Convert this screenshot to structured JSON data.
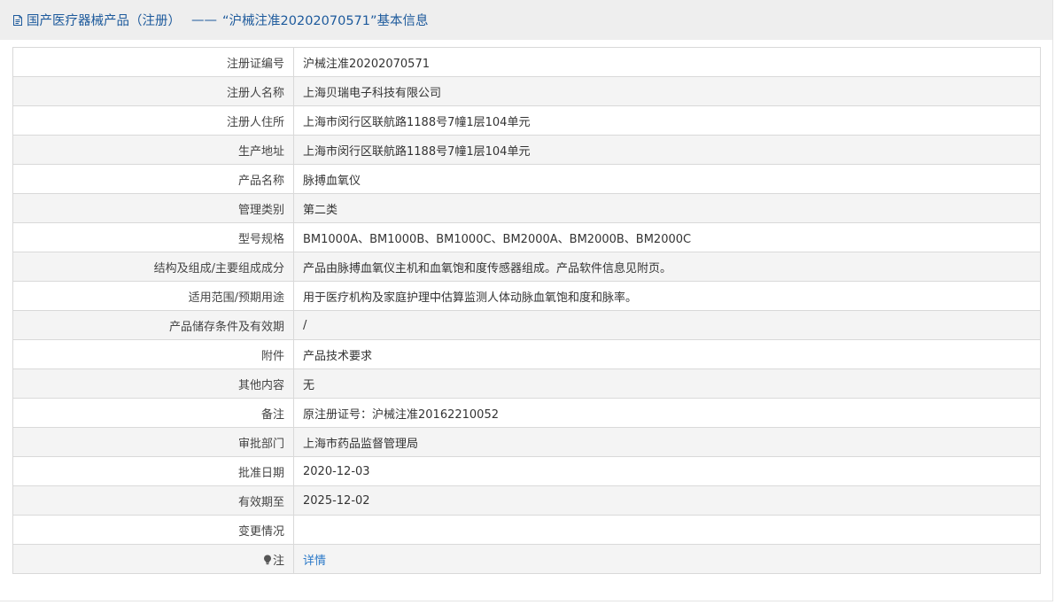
{
  "header": {
    "title_prefix": "国产医疗器械产品（注册）",
    "title_dash": "——",
    "title_main": "“沪械注准20202070571”基本信息",
    "icon": "document-icon"
  },
  "rows": [
    {
      "label": "注册证编号",
      "value": "沪械注准20202070571"
    },
    {
      "label": "注册人名称",
      "value": "上海贝瑞电子科技有限公司"
    },
    {
      "label": "注册人住所",
      "value": "上海市闵行区联航路1188号7幢1层104单元"
    },
    {
      "label": "生产地址",
      "value": "上海市闵行区联航路1188号7幢1层104单元"
    },
    {
      "label": "产品名称",
      "value": "脉搏血氧仪"
    },
    {
      "label": "管理类别",
      "value": "第二类"
    },
    {
      "label": "型号规格",
      "value": "BM1000A、BM1000B、BM1000C、BM2000A、BM2000B、BM2000C"
    },
    {
      "label": "结构及组成/主要组成成分",
      "value": "产品由脉搏血氧仪主机和血氧饱和度传感器组成。产品软件信息见附页。"
    },
    {
      "label": "适用范围/预期用途",
      "value": "用于医疗机构及家庭护理中估算监测人体动脉血氧饱和度和脉率。"
    },
    {
      "label": "产品储存条件及有效期",
      "value": "/"
    },
    {
      "label": "附件",
      "value": "产品技术要求"
    },
    {
      "label": "其他内容",
      "value": "无"
    },
    {
      "label": "备注",
      "value": "原注册证号：沪械注准20162210052"
    },
    {
      "label": "审批部门",
      "value": "上海市药品监督管理局"
    },
    {
      "label": "批准日期",
      "value": "2020-12-03"
    },
    {
      "label": "有效期至",
      "value": "2025-12-02"
    },
    {
      "label": "变更情况",
      "value": ""
    }
  ],
  "note_row": {
    "icon": "lightbulb-icon",
    "label": "注",
    "link_text": "详情"
  },
  "colors": {
    "header_text": "#1d5a9c",
    "header_bg": "#eeeeee",
    "link": "#2a78c8",
    "row_alt": "#f4f4f4"
  }
}
